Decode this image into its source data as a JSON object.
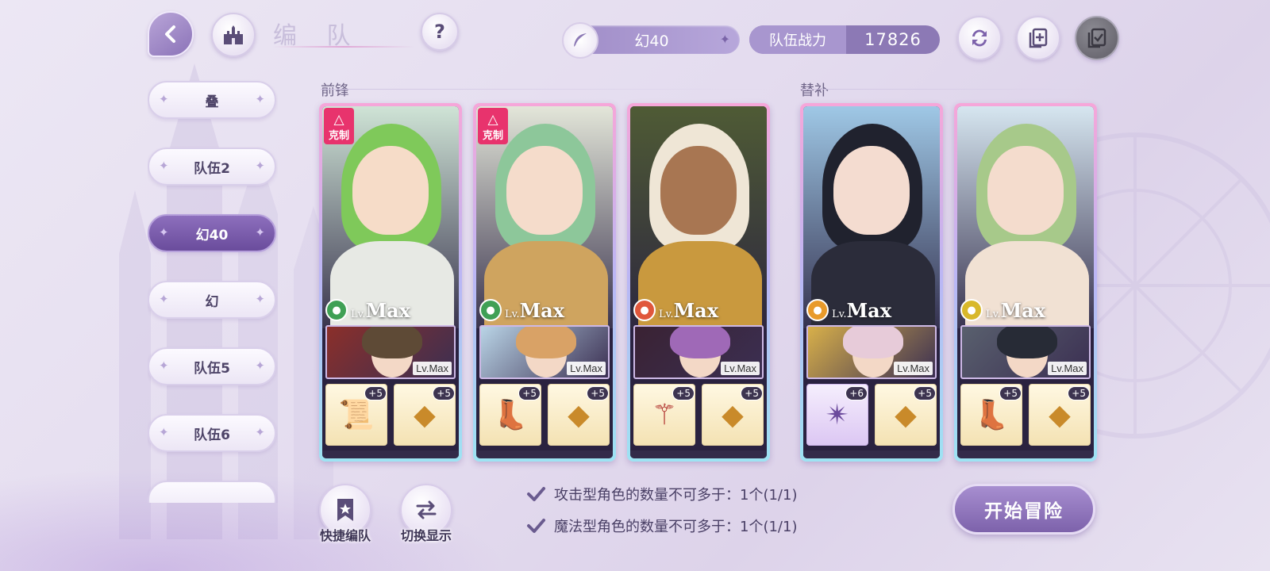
{
  "header": {
    "title": "编 队",
    "team_name": "幻40",
    "power_label": "队伍战力",
    "power_value": "17826"
  },
  "sidebar": {
    "teams": [
      {
        "label": "叠",
        "active": false
      },
      {
        "label": "队伍2",
        "active": false
      },
      {
        "label": "幻40",
        "active": true
      },
      {
        "label": "幻",
        "active": false
      },
      {
        "label": "队伍5",
        "active": false
      },
      {
        "label": "队伍6",
        "active": false
      },
      {
        "label": "",
        "active": false
      }
    ]
  },
  "sections": {
    "front": "前锋",
    "bench": "替补"
  },
  "cards": [
    {
      "counter": "克制",
      "element_color": "#3fa055",
      "element_icon": "leaf-icon",
      "lv_prefix": "Lv.",
      "lv": "Max",
      "sub_lv": "Lv.Max",
      "hair": "#7fc95a",
      "skin": "#f6dcc8",
      "outfit": "#e7e9e4",
      "bg": "#cfe4d6",
      "sub_hair": "#5e4a36",
      "sub_bg": "#8b2f2a",
      "equip": [
        {
          "plus": "+5",
          "icon": "book-icon",
          "glyph": "📜",
          "style": "gold"
        },
        {
          "plus": "+5",
          "icon": "gem-pair-icon",
          "glyph": "◆",
          "style": "gold"
        }
      ]
    },
    {
      "counter": "克制",
      "element_color": "#3fa055",
      "element_icon": "leaf-icon",
      "lv_prefix": "Lv.",
      "lv": "Max",
      "sub_lv": "Lv.Max",
      "hair": "#8dc79a",
      "skin": "#f5dccb",
      "outfit": "#cfa45f",
      "bg": "#e3e6d9",
      "sub_hair": "#d9a266",
      "sub_bg": "#b9d4e6",
      "equip": [
        {
          "plus": "+5",
          "icon": "boot-icon",
          "glyph": "👢",
          "style": "gold"
        },
        {
          "plus": "+5",
          "icon": "gem-pair-icon",
          "glyph": "◆",
          "style": "gold"
        }
      ]
    },
    {
      "counter": "",
      "element_color": "#e0573c",
      "element_icon": "flame-icon",
      "lv_prefix": "Lv.",
      "lv": "Max",
      "sub_lv": "Lv.Max",
      "hair": "#efe6d6",
      "skin": "#a87652",
      "outfit": "#c9993e",
      "bg": "#4f5b35",
      "sub_hair": "#9f69b7",
      "sub_bg": "#3a2233",
      "equip": [
        {
          "plus": "+5",
          "icon": "scepter-icon",
          "glyph": "⚚",
          "style": "gold"
        },
        {
          "plus": "+5",
          "icon": "gem-pair-icon",
          "glyph": "◆",
          "style": "gold"
        }
      ]
    },
    {
      "counter": "",
      "element_color": "#e89a2a",
      "element_icon": "fist-icon",
      "lv_prefix": "Lv.",
      "lv": "Max",
      "sub_lv": "Lv.Max",
      "hair": "#20222e",
      "skin": "#f4dcd0",
      "outfit": "#2b2c3a",
      "bg": "#9fc8e6",
      "sub_hair": "#e7cbd9",
      "sub_bg": "#d8b04a",
      "equip": [
        {
          "plus": "+6",
          "icon": "claw-icon",
          "glyph": "✴",
          "style": "purple"
        },
        {
          "plus": "+5",
          "icon": "gem-pair-icon",
          "glyph": "◆",
          "style": "gold"
        }
      ]
    },
    {
      "counter": "",
      "element_color": "#d8b82a",
      "element_icon": "fist-icon",
      "lv_prefix": "Lv.",
      "lv": "Max",
      "sub_lv": "Lv.Max",
      "hair": "#a7c98a",
      "skin": "#f4dccd",
      "outfit": "#f1e1d3",
      "bg": "#d6e6f0",
      "sub_hair": "#272b36",
      "sub_bg": "#59606e",
      "equip": [
        {
          "plus": "+5",
          "icon": "boot-icon",
          "glyph": "👢",
          "style": "gold"
        },
        {
          "plus": "+5",
          "icon": "gem-pair-icon",
          "glyph": "◆",
          "style": "gold"
        }
      ]
    }
  ],
  "bottom": {
    "quick_label": "快捷编队",
    "switch_label": "切换显示",
    "rules": [
      "攻击型角色的数量不可多于：1个(1/1)",
      "魔法型角色的数量不可多于：1个(1/1)"
    ],
    "start_label": "开始冒险"
  },
  "colors": {
    "accent": "#7d62ab",
    "active_tab": "#6a4c9c",
    "counter_badge": "#e8336d"
  }
}
